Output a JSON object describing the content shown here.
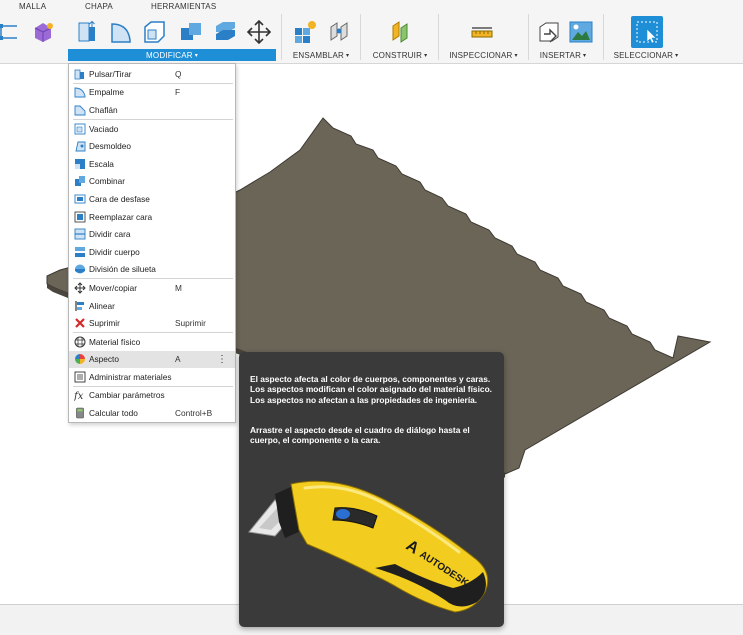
{
  "toolbar": {
    "tabs": {
      "mesh": "MALLA",
      "sheet": "CHAPA",
      "tools": "HERRAMIENTAS"
    },
    "groups": {
      "modify": "MODIFICAR",
      "assemble": "ENSAMBLAR",
      "construct": "CONSTRUIR",
      "inspect": "INSPECCIONAR",
      "insert": "INSERTAR",
      "select": "SELECCIONAR"
    },
    "caret": "▾",
    "active_color": "#1e8fd7"
  },
  "menu": {
    "items": [
      {
        "label": "Pulsar/Tirar",
        "shortcut": "Q",
        "icon": "press-pull-icon"
      },
      {
        "label": "Empalme",
        "shortcut": "F",
        "icon": "fillet-icon"
      },
      {
        "label": "Chaflán",
        "shortcut": "",
        "icon": "chamfer-icon"
      },
      {
        "label": "Vaciado",
        "shortcut": "",
        "icon": "shell-icon"
      },
      {
        "label": "Desmoldeo",
        "shortcut": "",
        "icon": "draft-icon"
      },
      {
        "label": "Escala",
        "shortcut": "",
        "icon": "scale-icon"
      },
      {
        "label": "Combinar",
        "shortcut": "",
        "icon": "combine-icon"
      },
      {
        "label": "Cara de desfase",
        "shortcut": "",
        "icon": "offset-face-icon"
      },
      {
        "label": "Reemplazar cara",
        "shortcut": "",
        "icon": "replace-face-icon"
      },
      {
        "label": "Dividir cara",
        "shortcut": "",
        "icon": "split-face-icon"
      },
      {
        "label": "Dividir cuerpo",
        "shortcut": "",
        "icon": "split-body-icon"
      },
      {
        "label": "División de silueta",
        "shortcut": "",
        "icon": "silhouette-split-icon"
      },
      {
        "label": "Mover/copiar",
        "shortcut": "M",
        "icon": "move-icon"
      },
      {
        "label": "Alinear",
        "shortcut": "",
        "icon": "align-icon"
      },
      {
        "label": "Suprimir",
        "shortcut": "Suprimir",
        "icon": "delete-icon"
      },
      {
        "label": "Material físico",
        "shortcut": "",
        "icon": "physical-material-icon"
      },
      {
        "label": "Aspecto",
        "shortcut": "A",
        "icon": "appearance-icon",
        "more": "⋮"
      },
      {
        "label": "Administrar materiales",
        "shortcut": "",
        "icon": "manage-materials-icon"
      },
      {
        "label": "Cambiar parámetros",
        "shortcut": "",
        "icon": "change-parameters-icon"
      },
      {
        "label": "Calcular todo",
        "shortcut": "Control+B",
        "icon": "compute-all-icon"
      }
    ],
    "highlight_color": "#e3e3e3"
  },
  "tooltip": {
    "para1": "El aspecto afecta al color de cuerpos, componentes y caras. Los aspectos modifican el color asignado del material físico. Los aspectos no afectan a las propiedades de ingeniería.",
    "para2": "Arrastre el aspecto desde el cuadro de diálogo hasta el cuerpo, el componente o la cara.",
    "brand": "AUTODESK",
    "background": "#3a3a3a"
  },
  "viewport": {
    "plate_color": "#6b6558"
  }
}
